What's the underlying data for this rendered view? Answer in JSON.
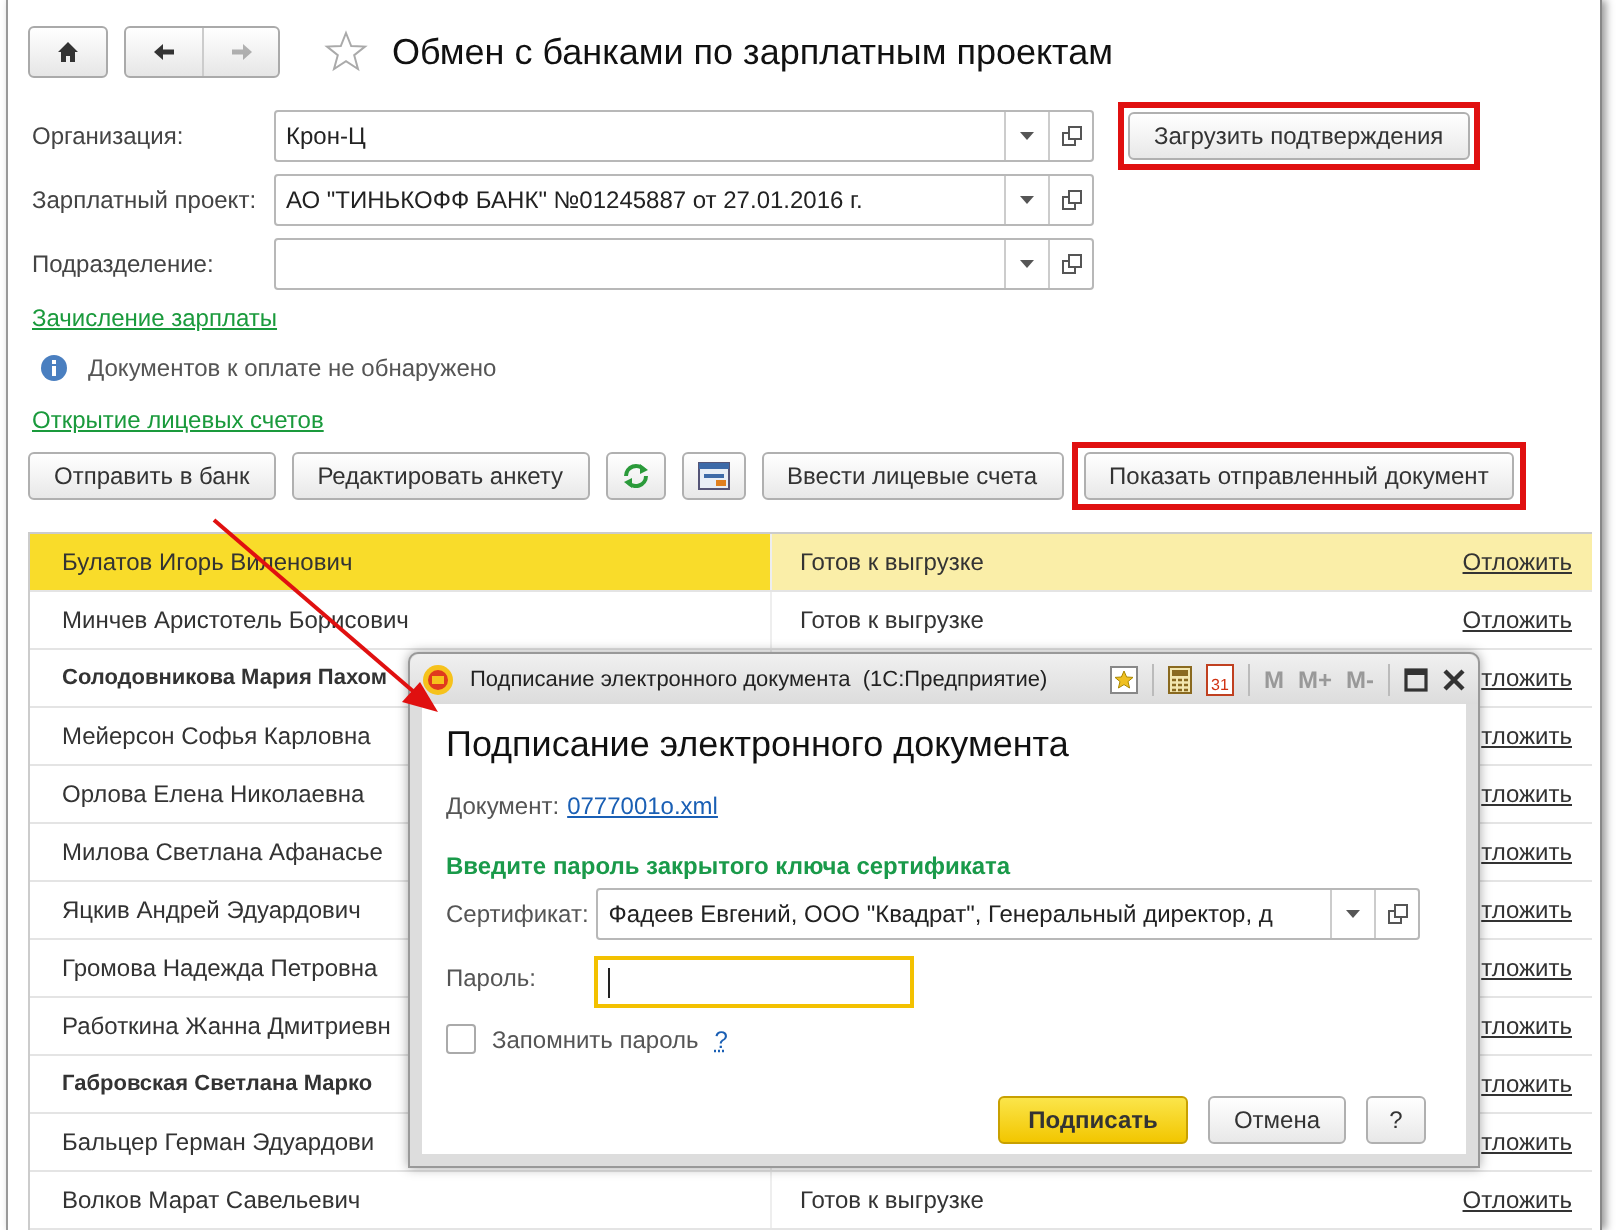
{
  "window": {
    "title": "Обмен с банками по зарплатным проектам",
    "favorite": false,
    "nav": [
      {
        "kind": "home",
        "disabled": false
      },
      {
        "kind": "back",
        "disabled": false
      },
      {
        "kind": "forward",
        "disabled": true
      }
    ]
  },
  "fields": [
    {
      "label": "Организация:",
      "value": "Крон-Ц"
    },
    {
      "label": "Зарплатный проект:",
      "value": "АО \"ТИНЬКОФФ БАНК\" №01245887 от 27.01.2016 г."
    },
    {
      "label": "Подразделение:"
    }
  ],
  "load_button": {
    "label": "Загрузить подтверждения",
    "highlighted": true
  },
  "salary_link": "Зачисление зарплаты",
  "info_message": "Документов к оплате не обнаружено",
  "accounts_link": "Открытие лицевых счетов",
  "toolbar": [
    {
      "kind": "text",
      "label": "Отправить в банк",
      "highlighted": false
    },
    {
      "kind": "text",
      "label": "Редактировать анкету",
      "highlighted": false
    },
    {
      "kind": "refresh",
      "highlighted": false
    },
    {
      "kind": "card",
      "highlighted": false
    },
    {
      "kind": "text",
      "label": "Ввести лицевые счета",
      "highlighted": false
    },
    {
      "kind": "text",
      "label": "Показать отправленный документ",
      "highlighted": true
    }
  ],
  "table": {
    "rows": [
      {
        "name": "Булатов Игорь Виленович",
        "bold": false,
        "status": "Готов к выгрузке",
        "action": "Отложить",
        "selected": true
      },
      {
        "name": "Минчев Аристотель Борисович",
        "bold": false,
        "status": "Готов к выгрузке",
        "action": "Отложить",
        "selected": false
      },
      {
        "name": "Солодовникова Мария Пахом",
        "bold": true,
        "action": "тложить",
        "selected": false
      },
      {
        "name": "Мейерсон Софья Карловна",
        "bold": false,
        "action": "тложить",
        "selected": false
      },
      {
        "name": "Орлова Елена Николаевна",
        "bold": false,
        "action": "тложить",
        "selected": false
      },
      {
        "name": "Милова Светлана Афанасье",
        "bold": false,
        "action": "тложить",
        "selected": false
      },
      {
        "name": "Яцкив Андрей Эдуардович",
        "bold": false,
        "action": "тложить",
        "selected": false
      },
      {
        "name": "Громова Надежда Петровна",
        "bold": false,
        "action": "тложить",
        "selected": false
      },
      {
        "name": "Работкина Жанна Дмитриевн",
        "bold": false,
        "action": "тложить",
        "selected": false
      },
      {
        "name": "Габровская Светлана Марко",
        "bold": true,
        "action": "тложить",
        "selected": false
      },
      {
        "name": "Бальцер Герман Эдуардови",
        "bold": false,
        "action": "тложить",
        "selected": false
      },
      {
        "name": "Волков Марат Савельевич",
        "bold": false,
        "status": "Готов к выгрузке",
        "action": "Отложить",
        "selected": false
      }
    ]
  },
  "dialog": {
    "title": "Подписание электронного документа  (1С:Предприятие)",
    "calendar_day": "31",
    "memory_buttons": [
      "M",
      "M+",
      "M-"
    ],
    "heading": "Подписание электронного документа",
    "document_label": "Документ:",
    "document_link": "0777001o.xml",
    "prompt": "Введите пароль закрытого ключа сертификата",
    "certificate_label": "Сертификат:",
    "certificate_value": "Фадеев Евгений, ООО \"Квадрат\", Генеральный директор, д",
    "password_label": "Пароль:",
    "remember": {
      "label": "Запомнить пароль",
      "checked": false,
      "help": "?"
    },
    "buttons": [
      {
        "kind": "primary",
        "label": "Подписать"
      },
      {
        "kind": "normal",
        "label": "Отмена"
      },
      {
        "kind": "normal",
        "label": "?"
      }
    ]
  }
}
